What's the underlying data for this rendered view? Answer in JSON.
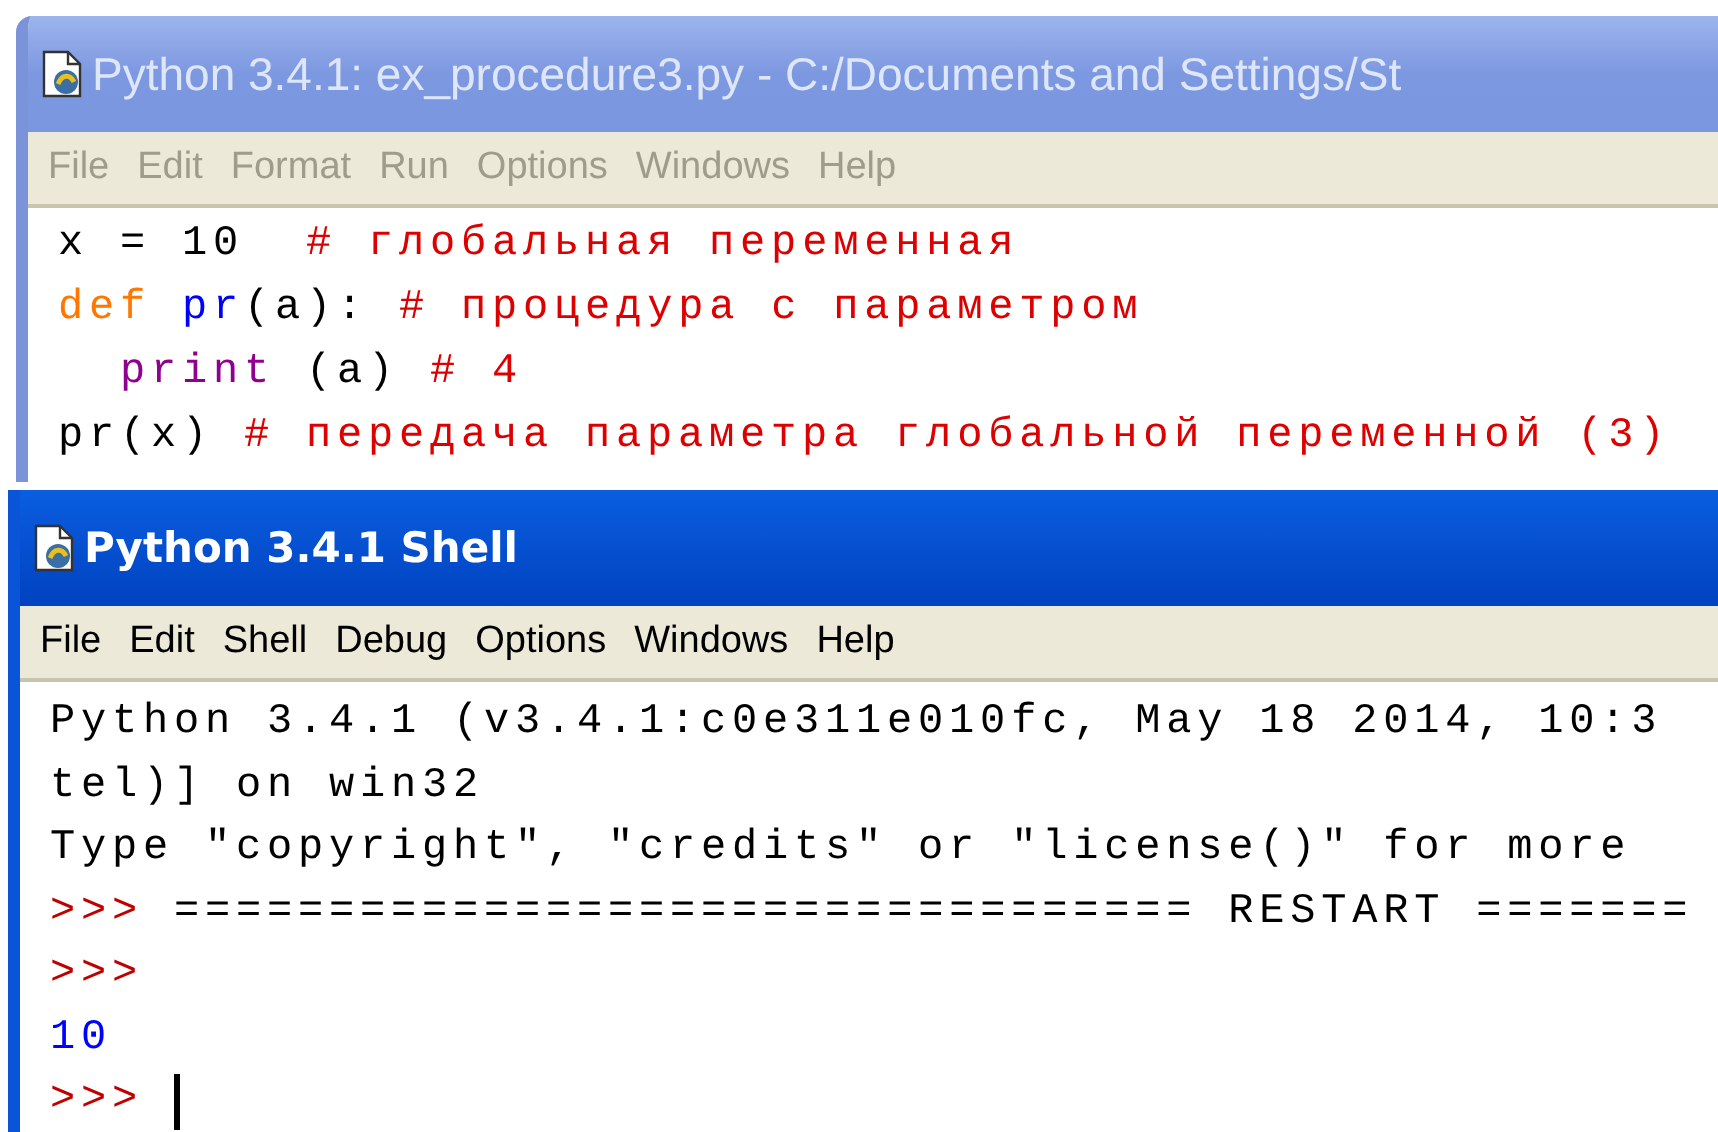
{
  "editor_window": {
    "title": "Python 3.4.1: ex_procedure3.py - C:/Documents and Settings/St",
    "active": false,
    "menu": [
      "File",
      "Edit",
      "Format",
      "Run",
      "Options",
      "Windows",
      "Help"
    ],
    "lines": [
      {
        "caret": false,
        "segments": [
          {
            "text": "x = 10  ",
            "kind": "default"
          },
          {
            "text": "# глобальная переменная",
            "kind": "comment"
          }
        ]
      },
      {
        "caret": false,
        "segments": [
          {
            "text": "def",
            "kind": "keyword"
          },
          {
            "text": " pr",
            "kind": "definition"
          },
          {
            "text": "(a): ",
            "kind": "default"
          },
          {
            "text": "# процедура с параметром",
            "kind": "comment"
          }
        ]
      },
      {
        "caret": false,
        "segments": [
          {
            "text": "  print",
            "kind": "builtin"
          },
          {
            "text": " (a) ",
            "kind": "default"
          },
          {
            "text": "# 4",
            "kind": "comment"
          }
        ]
      },
      {
        "caret": false,
        "segments": [
          {
            "text": "pr(x) ",
            "kind": "default"
          },
          {
            "text": "# передача параметра глобальной переменной (3)",
            "kind": "comment"
          }
        ]
      }
    ]
  },
  "shell_window": {
    "title": "Python 3.4.1 Shell",
    "active": true,
    "menu": [
      "File",
      "Edit",
      "Shell",
      "Debug",
      "Options",
      "Windows",
      "Help"
    ],
    "lines": [
      {
        "caret": false,
        "segments": [
          {
            "text": "Python 3.4.1 (v3.4.1:c0e311e010fc, May 18 2014, 10:3",
            "kind": "default"
          }
        ]
      },
      {
        "caret": false,
        "segments": [
          {
            "text": "tel)] on win32",
            "kind": "default"
          }
        ]
      },
      {
        "caret": false,
        "segments": [
          {
            "text": "Type \"copyright\", \"credits\" or \"license()\" for more",
            "kind": "default"
          }
        ]
      },
      {
        "caret": false,
        "segments": [
          {
            "text": ">>> ",
            "kind": "prompt"
          },
          {
            "text": "================================= RESTART =======",
            "kind": "default"
          }
        ]
      },
      {
        "caret": false,
        "segments": [
          {
            "text": ">>>",
            "kind": "prompt"
          }
        ]
      },
      {
        "caret": false,
        "segments": [
          {
            "text": "10",
            "kind": "stdout"
          }
        ]
      },
      {
        "caret": true,
        "segments": [
          {
            "text": ">>> ",
            "kind": "prompt"
          }
        ]
      }
    ]
  }
}
